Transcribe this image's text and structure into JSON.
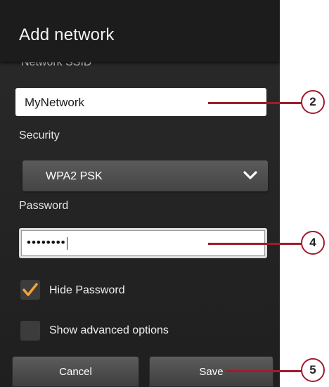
{
  "dialog": {
    "title": "Add network",
    "ssid_label": "Network SSID",
    "ssid_value": "MyNetwork",
    "security_label": "Security",
    "security_value": "WPA2 PSK",
    "password_label": "Password",
    "password_masked": "••••••••",
    "hide_password": {
      "label": "Hide Password",
      "checked": true
    },
    "show_advanced": {
      "label": "Show advanced options",
      "checked": false
    },
    "cancel_label": "Cancel",
    "save_label": "Save"
  },
  "callouts": [
    "2",
    "4",
    "5"
  ],
  "icons": {
    "dropdown": "chevron-down-icon",
    "checkbox_checked": "checkmark-icon"
  },
  "colors": {
    "callout": "#a01c2b",
    "check": "#f2a33a",
    "background": "#262626"
  }
}
